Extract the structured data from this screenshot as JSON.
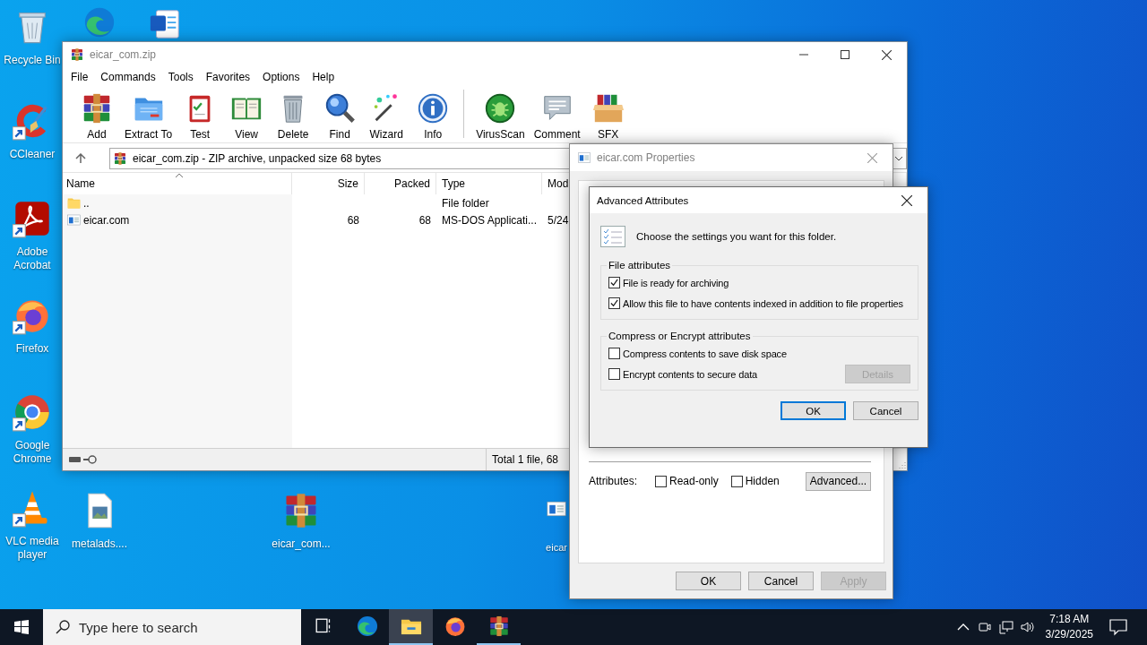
{
  "desktop": {
    "top_icons": [
      {
        "kind": "edge"
      },
      {
        "kind": "word"
      }
    ],
    "icons": [
      {
        "label": "Recycle Bin",
        "kind": "recycle",
        "shortcut": false
      },
      {
        "label": "CCleaner",
        "kind": "ccleaner",
        "shortcut": true
      },
      {
        "label": "Adobe Acrobat",
        "kind": "acrobat",
        "shortcut": true
      },
      {
        "label": "Firefox",
        "kind": "firefox",
        "shortcut": true
      },
      {
        "label": "Google Chrome",
        "kind": "chrome",
        "shortcut": true
      },
      {
        "label": "VLC media player",
        "kind": "vlc",
        "shortcut": true
      },
      {
        "label": "metalads....",
        "kind": "image",
        "shortcut": false
      },
      {
        "label": "eicar_com...",
        "kind": "rar",
        "shortcut": false
      },
      {
        "label": "eicar",
        "kind": "exe",
        "shortcut": false
      }
    ]
  },
  "winrar": {
    "title": "eicar_com.zip",
    "menu": [
      "File",
      "Commands",
      "Tools",
      "Favorites",
      "Options",
      "Help"
    ],
    "toolbar_groups": [
      [
        {
          "label": "Add",
          "kind": "rar"
        },
        {
          "label": "Extract To",
          "kind": "extract"
        },
        {
          "label": "Test",
          "kind": "test"
        },
        {
          "label": "View",
          "kind": "view"
        },
        {
          "label": "Delete",
          "kind": "delete"
        },
        {
          "label": "Find",
          "kind": "find"
        },
        {
          "label": "Wizard",
          "kind": "wizard"
        },
        {
          "label": "Info",
          "kind": "info"
        }
      ],
      [
        {
          "label": "VirusScan",
          "kind": "virusscan"
        },
        {
          "label": "Comment",
          "kind": "comment"
        },
        {
          "label": "SFX",
          "kind": "sfx"
        }
      ]
    ],
    "address": "eicar_com.zip - ZIP archive, unpacked size 68 bytes",
    "columns": [
      "Name",
      "Size",
      "Packed",
      "Type",
      "Mod"
    ],
    "rows": [
      {
        "kind": "folder",
        "name": "..",
        "type": "File folder"
      },
      {
        "kind": "exe",
        "name": "eicar.com",
        "size": "68",
        "packed": "68",
        "type": "MS-DOS Applicati...",
        "modified": "5/24"
      }
    ],
    "status": "Total 1 file, 68"
  },
  "properties": {
    "title": "eicar.com Properties",
    "attributes_label": "Attributes:",
    "attributes": [
      {
        "label": "Read-only",
        "checked": false
      },
      {
        "label": "Hidden",
        "checked": false
      }
    ],
    "advanced_button": "Advanced...",
    "buttons": [
      {
        "label": "OK",
        "disabled": false
      },
      {
        "label": "Cancel",
        "disabled": false
      },
      {
        "label": "Apply",
        "disabled": true
      }
    ]
  },
  "advanced": {
    "title": "Advanced Attributes",
    "intro": "Choose the settings you want for this folder.",
    "groups": [
      {
        "title": "File attributes",
        "options": [
          {
            "label": "File is ready for archiving",
            "checked": true
          },
          {
            "label": "Allow this file to have contents indexed in addition to file properties",
            "checked": true
          }
        ]
      },
      {
        "title": "Compress or Encrypt attributes",
        "options": [
          {
            "label": "Compress contents to save disk space",
            "checked": false
          },
          {
            "label": "Encrypt contents to secure data",
            "checked": false
          }
        ],
        "details_button": {
          "label": "Details",
          "disabled": true
        }
      }
    ],
    "buttons": [
      {
        "label": "OK",
        "default": true
      },
      {
        "label": "Cancel",
        "default": false
      }
    ]
  },
  "taskbar": {
    "search_placeholder": "Type here to search",
    "apps": [
      {
        "kind": "taskview",
        "selected": false,
        "running": false
      },
      {
        "kind": "edge",
        "selected": false,
        "running": false
      },
      {
        "kind": "explorer",
        "selected": true,
        "running": true
      },
      {
        "kind": "firefox",
        "selected": false,
        "running": false
      },
      {
        "kind": "rar",
        "selected": false,
        "running": true
      }
    ],
    "tray": [
      {
        "kind": "chevron"
      },
      {
        "kind": "meet"
      },
      {
        "kind": "network"
      },
      {
        "kind": "volume"
      }
    ],
    "time": "7:18 AM",
    "date": "3/29/2025"
  }
}
